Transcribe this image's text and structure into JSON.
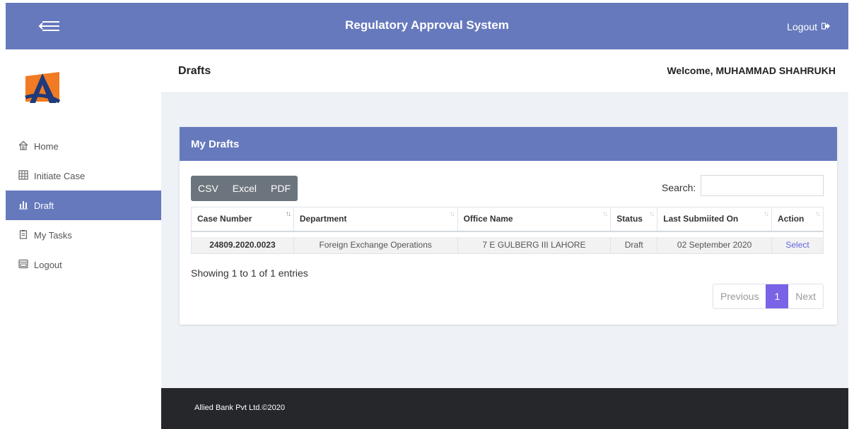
{
  "header": {
    "title": "Regulatory Approval System",
    "logout_label": "Logout"
  },
  "sidebar": {
    "items": [
      {
        "label": "Home",
        "icon": "home-icon"
      },
      {
        "label": "Initiate Case",
        "icon": "grid-icon"
      },
      {
        "label": "Draft",
        "icon": "bar-chart-icon",
        "active": true
      },
      {
        "label": "My Tasks",
        "icon": "clipboard-icon"
      },
      {
        "label": "Logout",
        "icon": "window-icon"
      }
    ]
  },
  "page": {
    "title": "Drafts",
    "welcome": "Welcome, MUHAMMAD SHAHRUKH"
  },
  "card": {
    "title": "My Drafts",
    "export_buttons": [
      "CSV",
      "Excel",
      "PDF"
    ],
    "search_label": "Search:",
    "search_value": "",
    "columns": [
      "Case Number",
      "Department",
      "Office Name",
      "Status",
      "Last Submiited On",
      "Action"
    ],
    "rows": [
      {
        "case_number": "24809.2020.0023",
        "department": "Foreign Exchange Operations",
        "office_name": "7 E GULBERG III LAHORE",
        "status": "Draft",
        "last_submitted": "02 September 2020",
        "action": "Select"
      }
    ],
    "info": "Showing 1 to 1 of 1 entries",
    "pagination": {
      "previous": "Previous",
      "current": "1",
      "next": "Next"
    }
  },
  "footer": {
    "text": "Allied Bank Pvt Ltd.©2020"
  },
  "colors": {
    "primary": "#6679bd",
    "footer": "#26272b",
    "content_bg": "#eef1f6",
    "pager_active": "#7a63e6",
    "link": "#6166e0"
  }
}
